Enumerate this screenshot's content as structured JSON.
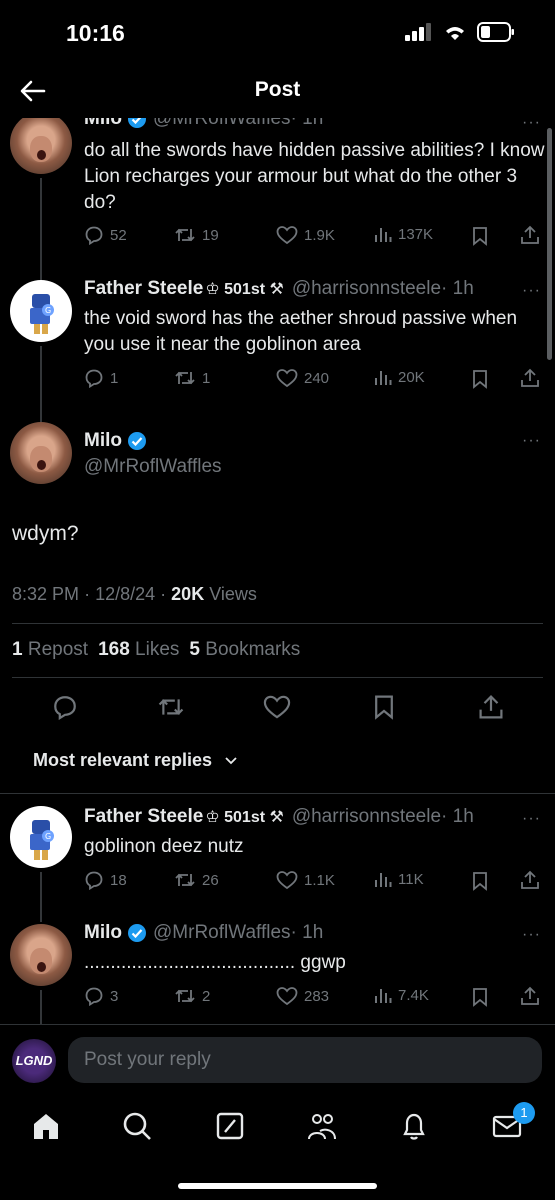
{
  "status_bar": {
    "time": "10:16"
  },
  "header": {
    "title": "Post"
  },
  "tweets": [
    {
      "name": "Milo",
      "handle": "@MrRoflWaffles",
      "time": "· 1h",
      "text": "do all the swords have hidden passive abilities? I know Lion recharges your armour but what do the other 3 do?",
      "replies": "52",
      "reposts": "19",
      "likes": "1.9K",
      "views": "137K"
    },
    {
      "name": "Father Steele",
      "name_suffix": "♔ 501st ⚒",
      "handle": "@harrisonnsteele",
      "time": "· 1h",
      "text": "the void sword has the aether shroud passive when you use it near the goblinon area",
      "replies": "1",
      "reposts": "1",
      "likes": "240",
      "views": "20K"
    }
  ],
  "main_post": {
    "name": "Milo",
    "handle": "@MrRoflWaffles",
    "text": "wdym?",
    "time": "8:32 PM",
    "date": "12/8/24",
    "views_count": "20K",
    "views_label": "Views",
    "separator": "·",
    "reposts_count": "1",
    "reposts_label": "Repost",
    "likes_count": "168",
    "likes_label": "Likes",
    "bookmarks_count": "5",
    "bookmarks_label": "Bookmarks"
  },
  "sort": {
    "label": "Most relevant replies"
  },
  "replies": [
    {
      "name": "Father Steele",
      "name_suffix": "♔ 501st ⚒",
      "handle": "@harrisonnsteele",
      "time": "· 1h",
      "text": "goblinon deez nutz",
      "replies": "18",
      "reposts": "26",
      "likes": "1.1K",
      "views": "11K"
    },
    {
      "name": "Milo",
      "handle": "@MrRoflWaffles",
      "time": "· 1h",
      "text": "........................................ ggwp",
      "replies": "3",
      "reposts": "2",
      "likes": "283",
      "views": "7.4K"
    }
  ],
  "reply_bar": {
    "avatar_text": "LGND",
    "placeholder": "Post your reply"
  },
  "tabbar": {
    "messages_badge": "1"
  },
  "colors": {
    "accent": "#1d9bf0",
    "background": "#000000",
    "muted": "#71767b"
  }
}
